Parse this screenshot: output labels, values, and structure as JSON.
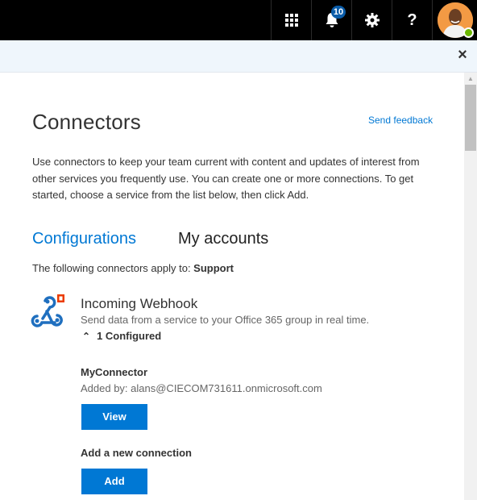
{
  "topbar": {
    "apps_icon": "waffle-icon",
    "notifications_icon": "bell-icon",
    "notifications_count": "10",
    "settings_icon": "gear-icon",
    "help_label": "?",
    "avatar_status": "available",
    "colors": {
      "background": "#000000",
      "badge": "#0a5ca8",
      "presence": "#6bb700"
    }
  },
  "panel": {
    "close_icon": "close-icon",
    "title": "Connectors",
    "feedback_link": "Send feedback",
    "description": "Use connectors to keep your team current with content and updates of interest from other services you frequently use. You can create one or more connections. To get started, choose a service from the list below, then click Add.",
    "tabs": [
      {
        "label": "Configurations",
        "active": true
      },
      {
        "label": "My accounts",
        "active": false
      }
    ],
    "applies_prefix": "The following connectors apply to: ",
    "applies_target": "Support"
  },
  "connector": {
    "icon": "webhook-icon",
    "name": "Incoming Webhook",
    "description": "Send data from a service to your Office 365 group in real time.",
    "configured_icon": "chevron-up-double-icon",
    "configured_label": "1 Configured",
    "connection": {
      "name": "MyConnector",
      "added_by": "Added by: alans@CIECOM731611.onmicrosoft.com",
      "view_label": "View"
    },
    "add_new_label": "Add a new connection",
    "add_label": "Add"
  },
  "colors": {
    "accent": "#0078d4",
    "subbar": "#eff6fc"
  }
}
